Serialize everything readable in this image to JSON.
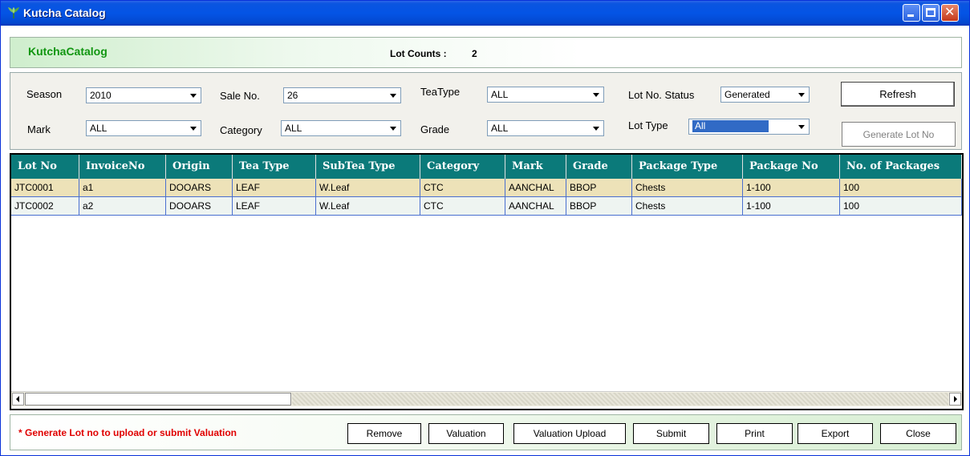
{
  "window": {
    "title": "Kutcha Catalog"
  },
  "header": {
    "title": "KutchaCatalog",
    "lot_counts_label": "Lot Counts :",
    "lot_counts_value": "2"
  },
  "filters": {
    "season": {
      "label": "Season",
      "value": "2010"
    },
    "sale_no": {
      "label": "Sale No.",
      "value": "26"
    },
    "tea_type": {
      "label": "TeaType",
      "value": "ALL"
    },
    "lot_no_status": {
      "label": "Lot No. Status",
      "value": "Generated"
    },
    "mark": {
      "label": "Mark",
      "value": "ALL"
    },
    "category": {
      "label": "Category",
      "value": "ALL"
    },
    "grade": {
      "label": "Grade",
      "value": "ALL"
    },
    "lot_type": {
      "label": "Lot Type",
      "value": "All"
    },
    "refresh_label": "Refresh",
    "generate_label": "Generate Lot No"
  },
  "grid": {
    "columns": [
      "Lot No",
      "InvoiceNo",
      "Origin",
      "Tea Type",
      "SubTea Type",
      "Category",
      "Mark",
      "Grade",
      "Package Type",
      "Package No",
      "No. of Packages"
    ],
    "rows": [
      [
        "JTC0001",
        "a1",
        "DOOARS",
        "LEAF",
        "W.Leaf",
        "CTC",
        "AANCHAL",
        "BBOP",
        "Chests",
        "1-100",
        "100"
      ],
      [
        "JTC0002",
        "a2",
        "DOOARS",
        "LEAF",
        "W.Leaf",
        "CTC",
        "AANCHAL",
        "BBOP",
        "Chests",
        "1-100",
        "100"
      ]
    ]
  },
  "footer": {
    "note": "* Generate Lot no to upload or submit Valuation",
    "buttons": {
      "remove": "Remove",
      "valuation": "Valuation",
      "valuation_upload": "Valuation Upload",
      "submit": "Submit",
      "print": "Print",
      "export": "Export",
      "close": "Close"
    }
  },
  "colors": {
    "grid_header": "#0b7a7a",
    "row_selected": "#ede2b8",
    "note_red": "#e00000",
    "header_green": "#119611"
  }
}
